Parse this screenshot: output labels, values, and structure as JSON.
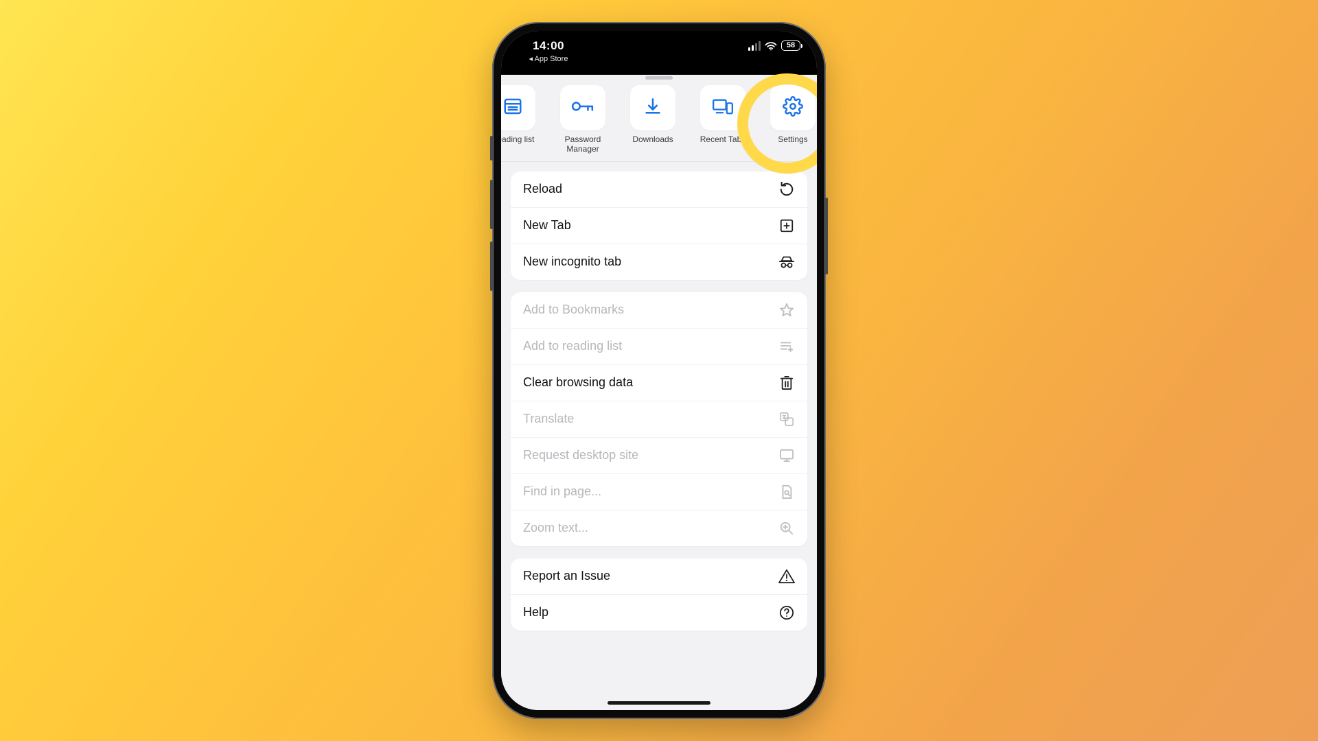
{
  "status": {
    "time": "14:00",
    "backText": "◂ App Store",
    "battery": "58"
  },
  "toolbar": {
    "items": [
      {
        "label": "Reading list",
        "icon": "reading-list-icon"
      },
      {
        "label": "Password\nManager",
        "icon": "key-icon"
      },
      {
        "label": "Downloads",
        "icon": "download-icon"
      },
      {
        "label": "Recent Tabs",
        "icon": "devices-icon"
      },
      {
        "label": "Settings",
        "icon": "gear-icon"
      }
    ]
  },
  "menu": {
    "group0": {
      "reload": "Reload",
      "newTab": "New Tab",
      "incognito": "New incognito tab"
    },
    "group1": {
      "bookmarks": "Add to Bookmarks",
      "readingList": "Add to reading list",
      "clearData": "Clear browsing data",
      "translate": "Translate",
      "desktop": "Request desktop site",
      "find": "Find in page...",
      "zoom": "Zoom text..."
    },
    "group2": {
      "report": "Report an Issue",
      "help": "Help"
    }
  },
  "colors": {
    "accent": "#1a73e8",
    "highlight": "#ffd94a"
  }
}
